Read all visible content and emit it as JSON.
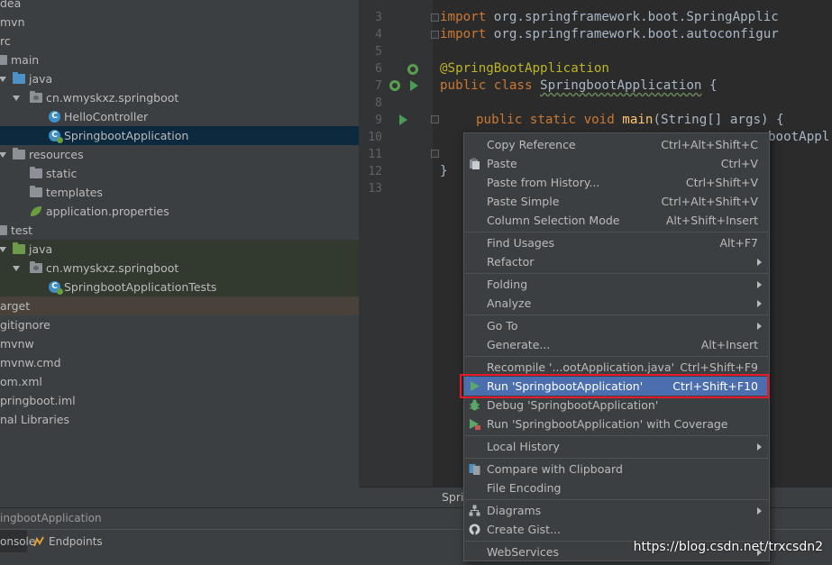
{
  "project_tree": {
    "items": [
      {
        "label": "dea"
      },
      {
        "label": "mvn"
      },
      {
        "label": "rc"
      },
      {
        "label": "main"
      },
      {
        "label": "java"
      },
      {
        "label": "cn.wmyskxz.springboot"
      },
      {
        "label": "HelloController"
      },
      {
        "label": "SpringbootApplication"
      },
      {
        "label": "resources"
      },
      {
        "label": "static"
      },
      {
        "label": "templates"
      },
      {
        "label": "application.properties"
      },
      {
        "label": "test"
      },
      {
        "label": "java"
      },
      {
        "label": "cn.wmyskxz.springboot"
      },
      {
        "label": "SpringbootApplicationTests"
      },
      {
        "label": "arget"
      },
      {
        "label": "gitignore"
      },
      {
        "label": "mvnw"
      },
      {
        "label": "mvnw.cmd"
      },
      {
        "label": "om.xml"
      },
      {
        "label": "pringboot.iml"
      },
      {
        "label": "nal Libraries"
      }
    ]
  },
  "editor": {
    "line_numbers": [
      "3",
      "4",
      "5",
      "6",
      "7",
      "8",
      "9",
      "10",
      "11",
      "12",
      "13"
    ],
    "lines": {
      "l3_kw": "import",
      "l3_rest": " org.springframework.boot.SpringApplic",
      "l4_kw": "import",
      "l4_rest": " org.springframework.boot.autoconfigur",
      "l6": "@SpringBootApplication",
      "l7_kw": "public class",
      "l7_name": "SpringbootApplication",
      "l7_rest": " {",
      "l9_kw": "public static void",
      "l9_fn": "main",
      "l9_rest": "(String[] args) {",
      "l10_frag": "bootAppl",
      "l12": "}"
    },
    "bottom_tab_fragment": "Spri"
  },
  "status_text": "ingbootApplication",
  "bottom_tabs": [
    {
      "label": "onsole"
    },
    {
      "label": "Endpoints"
    }
  ],
  "watermark": "https://blog.csdn.net/trxcsdn2",
  "context_menu": {
    "items": [
      {
        "label": "Copy Reference",
        "shortcut": "Ctrl+Alt+Shift+C",
        "icon": ""
      },
      {
        "label": "Paste",
        "shortcut": "Ctrl+V",
        "icon": "paste-icon"
      },
      {
        "label": "Paste from History...",
        "shortcut": "Ctrl+Shift+V",
        "icon": ""
      },
      {
        "label": "Paste Simple",
        "shortcut": "Ctrl+Alt+Shift+V",
        "icon": ""
      },
      {
        "label": "Column Selection Mode",
        "shortcut": "Alt+Shift+Insert",
        "icon": ""
      },
      {
        "label": "Find Usages",
        "shortcut": "Alt+F7",
        "icon": ""
      },
      {
        "label": "Refactor",
        "shortcut": "",
        "icon": "",
        "submenu": true
      },
      {
        "label": "Folding",
        "shortcut": "",
        "icon": "",
        "submenu": true
      },
      {
        "label": "Analyze",
        "shortcut": "",
        "icon": "",
        "submenu": true
      },
      {
        "label": "Go To",
        "shortcut": "",
        "icon": "",
        "submenu": true
      },
      {
        "label": "Generate...",
        "shortcut": "Alt+Insert",
        "icon": ""
      },
      {
        "label": "Recompile '...ootApplication.java'",
        "shortcut": "Ctrl+Shift+F9",
        "icon": ""
      },
      {
        "label": "Run 'SpringbootApplication'",
        "shortcut": "Ctrl+Shift+F10",
        "icon": "run-icon",
        "highlighted": true
      },
      {
        "label": "Debug 'SpringbootApplication'",
        "shortcut": "",
        "icon": "debug-icon"
      },
      {
        "label": "Run 'SpringbootApplication' with Coverage",
        "shortcut": "",
        "icon": "coverage-icon"
      },
      {
        "label": "Local History",
        "shortcut": "",
        "icon": "",
        "submenu": true
      },
      {
        "label": "Compare with Clipboard",
        "shortcut": "",
        "icon": "compare-icon"
      },
      {
        "label": "File Encoding",
        "shortcut": "",
        "icon": ""
      },
      {
        "label": "Diagrams",
        "shortcut": "",
        "icon": "diagram-icon",
        "submenu": true
      },
      {
        "label": "Create Gist...",
        "shortcut": "",
        "icon": "github-icon"
      },
      {
        "label": "WebServices",
        "shortcut": "",
        "icon": "",
        "submenu": true
      }
    ]
  },
  "colors": {
    "highlight": "#4b6eaf",
    "annotation_box": "#e8192c",
    "keyword": "#cc7832",
    "annotation": "#bbb529",
    "method": "#ffc66d"
  }
}
